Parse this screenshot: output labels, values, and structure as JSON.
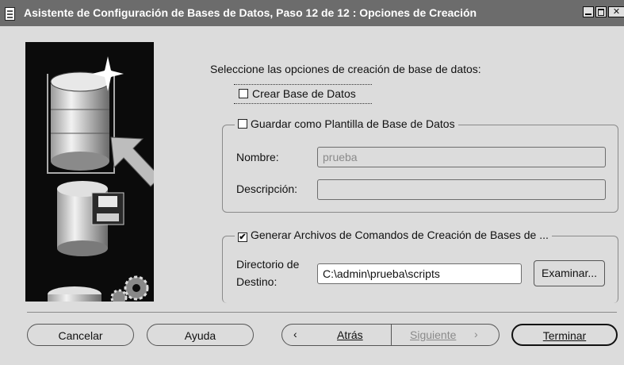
{
  "window": {
    "title": "Asistente de Configuración de Bases de Datos, Paso 12 de 12 : Opciones de Creación"
  },
  "main": {
    "prompt": "Seleccione las opciones de creación de base de datos:",
    "create_db": {
      "label": "Crear Base de Datos",
      "checked": false
    },
    "save_template": {
      "label": "Guardar como Plantilla de Base de Datos",
      "checked": false,
      "name_label": "Nombre:",
      "name_value": "prueba",
      "description_label": "Descripción:",
      "description_value": ""
    },
    "generate_scripts": {
      "label": "Generar Archivos de Comandos de Creación de Bases de ...",
      "checked": true,
      "dest_label_line1": "Directorio de",
      "dest_label_line2": "Destino:",
      "dest_value": "C:\\admin\\prueba\\scripts",
      "browse_label": "Examinar..."
    }
  },
  "footer": {
    "cancel": "Cancelar",
    "help": "Ayuda",
    "back": "Atrás",
    "next": "Siguiente",
    "finish": "Terminar"
  },
  "icons": {
    "app": "database-document-icon",
    "back": "chevron-left-icon",
    "next": "chevron-right-icon"
  }
}
